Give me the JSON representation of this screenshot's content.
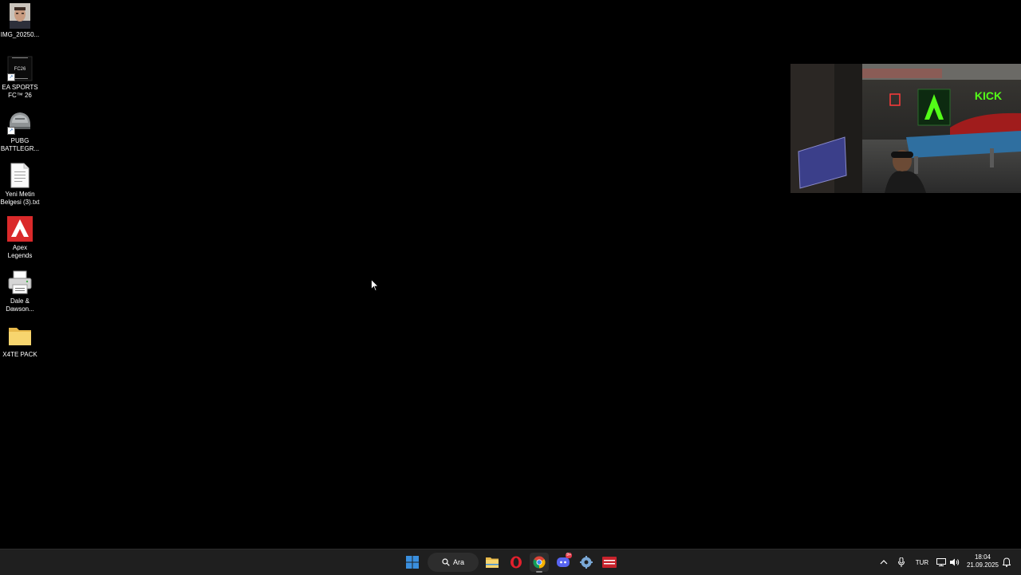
{
  "desktop": {
    "icons": [
      {
        "label": "IMG_20250...",
        "icon": "photo-thumbnail-icon"
      },
      {
        "label": "EA SPORTS\nFC™ 26",
        "icon": "ea-sports-fc-icon",
        "badge": "FC26"
      },
      {
        "label": "PUBG\nBATTLEGR...",
        "icon": "pubg-helmet-icon"
      },
      {
        "label": "Yeni Metin\nBelgesi (3).txt",
        "icon": "text-document-icon"
      },
      {
        "label": "Apex\nLegends",
        "icon": "apex-legends-icon"
      },
      {
        "label": "Dale &\nDawson...",
        "icon": "printer-icon"
      },
      {
        "label": "X4TE PACK",
        "icon": "folder-icon"
      }
    ]
  },
  "webcam": {
    "sign_text": "KICK",
    "icon": "webcam-overlay"
  },
  "taskbar": {
    "start_icon": "windows-start-icon",
    "search_label": "Ara",
    "apps": [
      {
        "icon": "file-explorer-icon"
      },
      {
        "icon": "opera-icon"
      },
      {
        "icon": "chrome-icon",
        "active": true
      },
      {
        "icon": "discord-icon",
        "badge": "9+"
      },
      {
        "icon": "settings-gear-icon"
      },
      {
        "icon": "video-editor-icon"
      }
    ],
    "tray": {
      "chevron_icon": "chevron-up-icon",
      "mic_icon": "microphone-icon",
      "language": "TUR",
      "network_icon": "network-icon",
      "volume_icon": "speaker-icon",
      "time": "18:04",
      "date": "21.09.2025",
      "notification_icon": "notification-bell-icon"
    }
  },
  "colors": {
    "taskbar_bg": "#1f1f1f",
    "desktop_bg": "#000000",
    "accent_blue": "#3a8fde",
    "kick_green": "#53fc18"
  }
}
